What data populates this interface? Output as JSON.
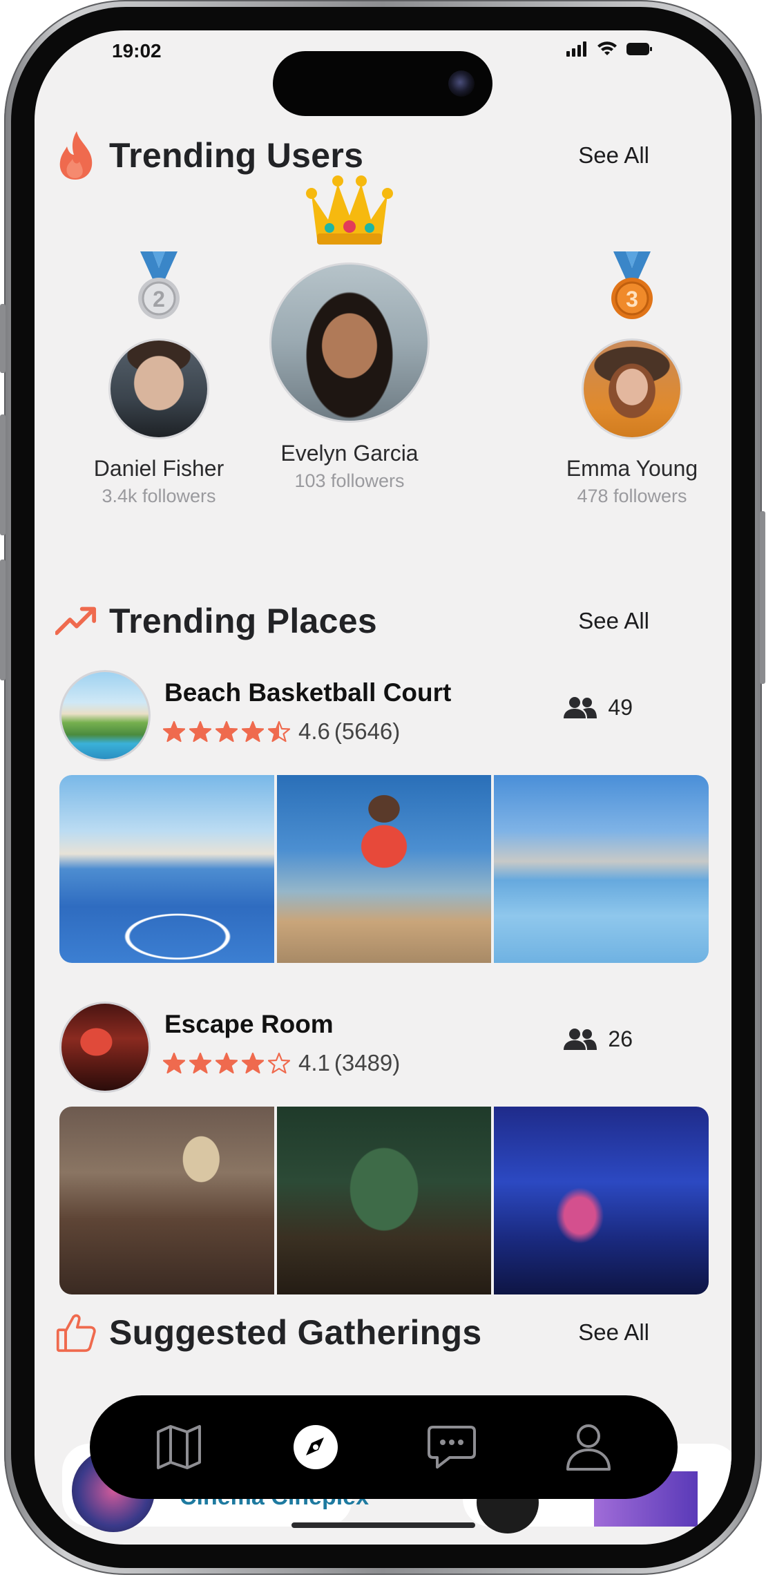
{
  "status_bar": {
    "time": "19:02"
  },
  "colors": {
    "accent": "#ef6a4e",
    "background": "#f2f1f1",
    "nav": "#000000"
  },
  "trending_users": {
    "title": "Trending Users",
    "see_all": "See All",
    "icon": "flame-icon",
    "users": [
      {
        "rank": 2,
        "badge": "silver-medal-icon",
        "medal_text": "2",
        "name": "Daniel Fisher",
        "followers": "3.4k followers"
      },
      {
        "rank": 1,
        "badge": "crown-icon",
        "name": "Evelyn Garcia",
        "followers": "103 followers"
      },
      {
        "rank": 3,
        "badge": "bronze-medal-icon",
        "medal_text": "3",
        "name": "Emma Young",
        "followers": "478 followers"
      }
    ]
  },
  "trending_places": {
    "title": "Trending Places",
    "see_all": "See All",
    "icon": "trending-up-icon",
    "places": [
      {
        "name": "Beach Basketball Court",
        "rating": 4.6,
        "rating_text": "4.6",
        "reviews": "(5646)",
        "attendees": "49"
      },
      {
        "name": "Escape Room",
        "rating": 4.1,
        "rating_text": "4.1",
        "reviews": "(3489)",
        "attendees": "26"
      }
    ]
  },
  "suggested_gatherings": {
    "title": "Suggested Gatherings",
    "see_all": "See All",
    "icon": "thumbs-up-icon",
    "peek_title": "Cinema Cineplex"
  },
  "bottom_nav": {
    "items": [
      {
        "name": "map",
        "icon": "map-icon"
      },
      {
        "name": "explore",
        "icon": "compass-icon",
        "active": true
      },
      {
        "name": "chat",
        "icon": "chat-bubble-icon"
      },
      {
        "name": "profile",
        "icon": "person-icon"
      }
    ]
  }
}
